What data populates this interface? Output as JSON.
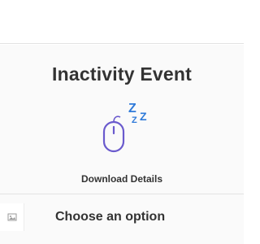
{
  "dialog": {
    "title": "Inactivity Event",
    "illustration": {
      "icons": [
        "mouse-icon",
        "sleep-zzz-icon"
      ],
      "accent_color": "#6a5acd",
      "zzz_color": "#2f7ad9",
      "zzz_text": "ZZZ"
    },
    "details_link": "Download Details",
    "section_title": "Choose an option"
  },
  "side_button": {
    "icon": "image-icon"
  }
}
